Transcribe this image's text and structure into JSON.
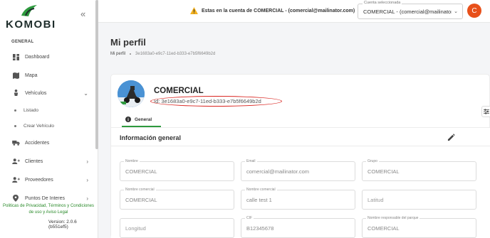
{
  "brand": {
    "name": "KOMOBI",
    "accent": "#2e9a3e"
  },
  "sidebar": {
    "collapse_icon": "double-chevron-left",
    "section_label": "GENERAL",
    "items": [
      {
        "label": "Dashboard",
        "icon": "dashboard-icon"
      },
      {
        "label": "Mapa",
        "icon": "map-icon"
      },
      {
        "label": "Vehículos",
        "icon": "vehicle-icon",
        "expanded": true
      },
      {
        "label": "Listado"
      },
      {
        "label": "Crear Vehículo"
      },
      {
        "label": "Accidentes",
        "icon": "truck-icon"
      },
      {
        "label": "Clientes",
        "icon": "users-icon"
      },
      {
        "label": "Proveedores",
        "icon": "users-icon"
      },
      {
        "label": "Puntos De Interes",
        "icon": "pin-icon"
      }
    ],
    "footer_links": "Politicas de Privacidad, Términos y Condiciones de uso y Aviso Legal",
    "version": "Version: 2.0.6 (b551ef5)"
  },
  "topbar": {
    "warning": "Estas en la cuenta de COMERCIAL - (comercial@mailinator.com)",
    "account_label": "Cuenta seleccionada",
    "account_value": "COMERCIAL - (comercial@mailinator.com)",
    "avatar_letter": "C"
  },
  "page": {
    "title": "Mi perfil",
    "breadcrumb_root": "Mi perfil",
    "breadcrumb_current": "3e1683a0-e9c7-11ed-b333-e7b5f6649b2d"
  },
  "profile": {
    "name": "COMERCIAL",
    "id_text": "Id: 3e1683a0-e9c7-11ed-b333-e7b5f6649b2d",
    "tab": "General"
  },
  "info": {
    "title": "Información general",
    "fields": [
      {
        "label": "Nombre",
        "value": "COMERCIAL"
      },
      {
        "label": "Email",
        "value": "comercial@mailinator.com"
      },
      {
        "label": "Grupo",
        "value": "COMERCIAL"
      },
      {
        "label": "Nombre comercial",
        "value": "COMERCIAL"
      },
      {
        "label": "Nombre comercial",
        "value": "calle test 1"
      },
      {
        "label": "",
        "value": "Latitud"
      },
      {
        "label": "",
        "value": "Longitud"
      },
      {
        "label": "CIF",
        "value": "B12345678"
      },
      {
        "label": "Nombre responsable del parque",
        "value": "COMERCIAL"
      }
    ]
  }
}
